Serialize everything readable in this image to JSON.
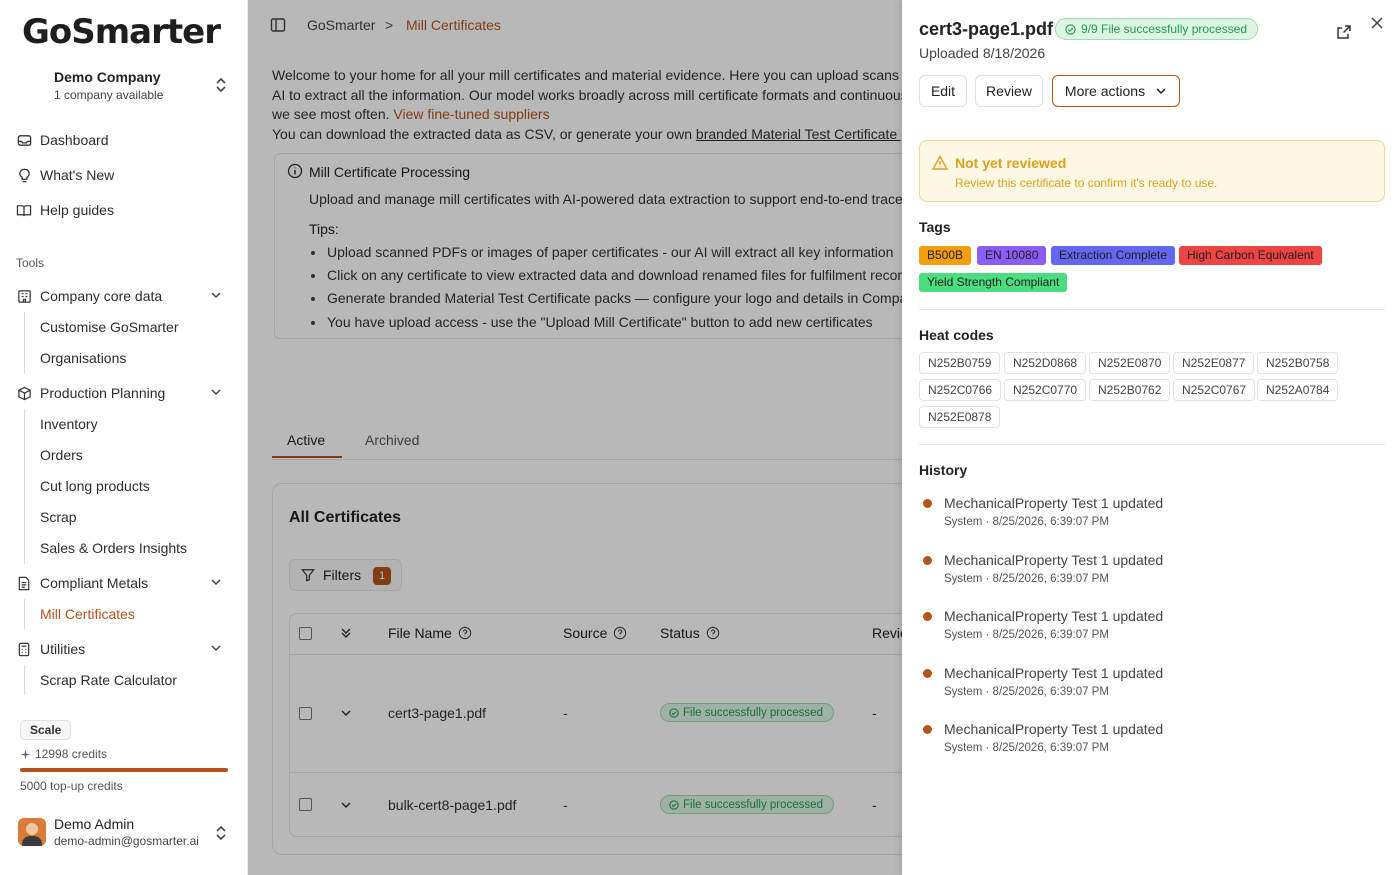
{
  "app": {
    "logo_text": "GoSmarter"
  },
  "company": {
    "name": "Demo Company",
    "sub": "1 company available"
  },
  "nav": {
    "dashboard": "Dashboard",
    "whats_new": "What's New",
    "help": "Help guides",
    "tools_label": "Tools",
    "company_core": "Company core data",
    "customise": "Customise GoSmarter",
    "organisations": "Organisations",
    "production": "Production Planning",
    "inventory": "Inventory",
    "orders": "Orders",
    "cut_long": "Cut long products",
    "scrap": "Scrap",
    "insights": "Sales & Orders Insights",
    "compliant": "Compliant Metals",
    "mill_certs": "Mill Certificates",
    "utilities": "Utilities",
    "scrap_rate": "Scrap Rate Calculator"
  },
  "plan": {
    "badge": "Scale",
    "credits": "12998 credits",
    "topup": "5000 top-up credits",
    "credits_used_fraction": 1.0
  },
  "user": {
    "name": "Demo Admin",
    "email": "demo-admin@gosmarter.ai"
  },
  "breadcrumb": {
    "home": "GoSmarter",
    "sep": ">",
    "current": "Mill Certificates"
  },
  "intro": {
    "line1": "Welcome to your home for all your mill certificates and material evidence. Here you can upload scans of",
    "line2": "AI to extract all the information. Our model works broadly across mill certificate formats and continuousl",
    "line3_pre": "we see most often. ",
    "line3_link": "View fine-tuned suppliers",
    "line4_pre": "You can download the extracted data as CSV, or generate your own ",
    "line4_link": "branded Material Test Certificate pac"
  },
  "info": {
    "title": "Mill Certificate Processing",
    "desc": "Upload and manage mill certificates with AI-powered data extraction to support end-to-end traceab",
    "tips_label": "Tips:",
    "tips": [
      "Upload scanned PDFs or images of paper certificates - our AI will extract all key information",
      "Click on any certificate to view extracted data and download renamed files for fulfilment records",
      "Generate branded Material Test Certificate packs — configure your logo and details in Company",
      "You have upload access - use the \"Upload Mill Certificate\" button to add new certificates"
    ]
  },
  "tabs": {
    "active": "Active",
    "archived": "Archived"
  },
  "certs": {
    "title": "All Certificates",
    "filters_label": "Filters",
    "filters_count": "1",
    "columns": {
      "file_name": "File Name",
      "source": "Source",
      "status": "Status",
      "review": "Revie"
    },
    "rows": [
      {
        "file": "cert3-page1.pdf",
        "source": "-",
        "status": "File successfully processed",
        "review": "-"
      },
      {
        "file": "bulk-cert8-page1.pdf",
        "source": "-",
        "status": "File successfully processed",
        "review": "-"
      }
    ]
  },
  "drawer": {
    "title": "cert3-page1.pdf",
    "processed": "9/9 File successfully processed",
    "uploaded": "Uploaded 8/18/2026",
    "edit": "Edit",
    "review": "Review",
    "more": "More actions",
    "warn_title": "Not yet reviewed",
    "warn_sub": "Review this certificate to confirm it's ready to use.",
    "tags_label": "Tags",
    "tags": [
      {
        "label": "B500B",
        "bg": "#f59e0b",
        "fg": "#1f1f1f"
      },
      {
        "label": "EN 10080",
        "bg": "#8b5cf6",
        "fg": "#1f1f1f"
      },
      {
        "label": "Extraction Complete",
        "bg": "#6366f1",
        "fg": "#1f1f1f"
      },
      {
        "label": "High Carbon Equivalent",
        "bg": "#ef4444",
        "fg": "#1f1f1f"
      },
      {
        "label": "Yield Strength Compliant",
        "bg": "#4ade80",
        "fg": "#1f1f1f"
      }
    ],
    "heat_label": "Heat codes",
    "heat_codes": [
      "N252B0759",
      "N252D0868",
      "N252E0870",
      "N252E0877",
      "N252B0758",
      "N252C0766",
      "N252C0770",
      "N252B0762",
      "N252C0767",
      "N252A0784",
      "N252E0878"
    ],
    "history_label": "History",
    "history": [
      {
        "text": "MechanicalProperty Test 1 updated",
        "meta": "System · 8/25/2026, 6:39:07 PM"
      },
      {
        "text": "MechanicalProperty Test 1 updated",
        "meta": "System · 8/25/2026, 6:39:07 PM"
      },
      {
        "text": "MechanicalProperty Test 1 updated",
        "meta": "System · 8/25/2026, 6:39:07 PM"
      },
      {
        "text": "MechanicalProperty Test 1 updated",
        "meta": "System · 8/25/2026, 6:39:07 PM"
      },
      {
        "text": "MechanicalProperty Test 1 updated",
        "meta": "System · 8/25/2026, 6:39:07 PM"
      }
    ]
  },
  "colors": {
    "accent": "#b4541b",
    "success": "#1f9d4d",
    "warning": "#d9a21d"
  }
}
